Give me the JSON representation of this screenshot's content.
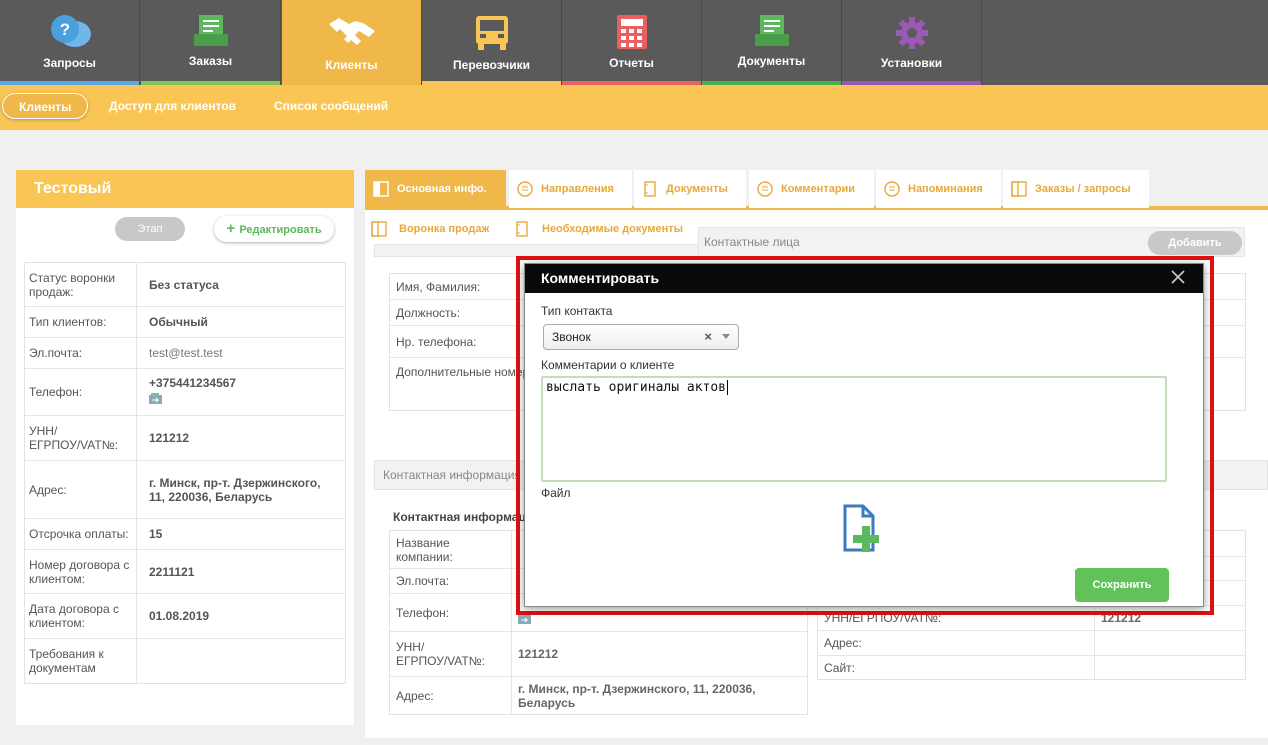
{
  "topnav": {
    "tabs": [
      {
        "label": "Запросы",
        "icon": "question-bubbles-icon",
        "bar": "#5aa9e6"
      },
      {
        "label": "Заказы",
        "icon": "order-tray-icon",
        "bar": "#7dc64f"
      },
      {
        "label": "Клиенты",
        "icon": "handshake-icon",
        "bar": "#f0b849"
      },
      {
        "label": "Перевозчики",
        "icon": "truck-icon",
        "bar": "#f9c555"
      },
      {
        "label": "Отчеты",
        "icon": "calculator-icon",
        "bar": "#e86060"
      },
      {
        "label": "Документы",
        "icon": "documents-tray-icon",
        "bar": "#4caf50"
      },
      {
        "label": "Установки",
        "icon": "gear-icon",
        "bar": "#9b59b6"
      }
    ]
  },
  "subnav": {
    "items": [
      "Клиенты",
      "Доступ для клиентов",
      "Список сообщений"
    ]
  },
  "client": {
    "name": "Тестовый",
    "stage_button": "Этап",
    "edit_button": "Редактировать",
    "fields": [
      {
        "label": "Статус воронки продаж:",
        "value": "Без статуса"
      },
      {
        "label": "Тип клиентов:",
        "value": "Обычный"
      },
      {
        "label": "Эл.почта:",
        "value": "test@test.test"
      },
      {
        "label": "Телефон:",
        "value": "+375441234567"
      },
      {
        "label": "УНН/ ЕГРПОУ/VAT№:",
        "value": "121212"
      },
      {
        "label": "Адрес:",
        "value": "г. Минск, пр-т. Дзержинского, 11, 220036, Беларусь"
      },
      {
        "label": "Отсрочка оплаты:",
        "value": "15"
      },
      {
        "label": "Номер договора с клиентом:",
        "value": "2211121"
      },
      {
        "label": "Дата договора с клиентом:",
        "value": "01.08.2019"
      },
      {
        "label": "Требования к документам",
        "value": ""
      }
    ]
  },
  "detail_tabs": {
    "row1": [
      "Основная инфо.",
      "Направления",
      "Документы",
      "Комментарии",
      "Напоминания",
      "Заказы / запросы"
    ],
    "row2": [
      "Воронка продаж",
      "Необходимые документы"
    ]
  },
  "contacts": {
    "title": "Контактные лица",
    "add_button": "Добавить",
    "fields": [
      "Имя, Фамилия:",
      "Должность:",
      "Нр. телефона:",
      "Дополнительные номера"
    ]
  },
  "contact_info": {
    "title": "Контактная информация",
    "subtitle": "Контактная информация",
    "fields": [
      {
        "label": "Название компании:",
        "value": ""
      },
      {
        "label": "Эл.почта:",
        "value": ""
      },
      {
        "label": "Телефон:",
        "value": ""
      },
      {
        "label": "УНН/ ЕГРПОУ/VAT№:",
        "value": "121212"
      },
      {
        "label": "Адрес:",
        "value": "г. Минск, пр-т. Дзержинского, 11, 220036, Беларусь"
      }
    ],
    "right_fields": [
      {
        "label": "УНН/ЕГРПОУ/VAT№:",
        "value": "121212"
      },
      {
        "label": "Адрес:",
        "value": ""
      },
      {
        "label": "Сайт:",
        "value": ""
      }
    ]
  },
  "modal": {
    "title": "Комментировать",
    "contact_type_label": "Тип контакта",
    "contact_type_value": "Звонок",
    "comment_label": "Комментарии о клиенте",
    "comment_value": "выслать оригиналы актов",
    "file_label": "Файл",
    "save_button": "Сохранить"
  }
}
